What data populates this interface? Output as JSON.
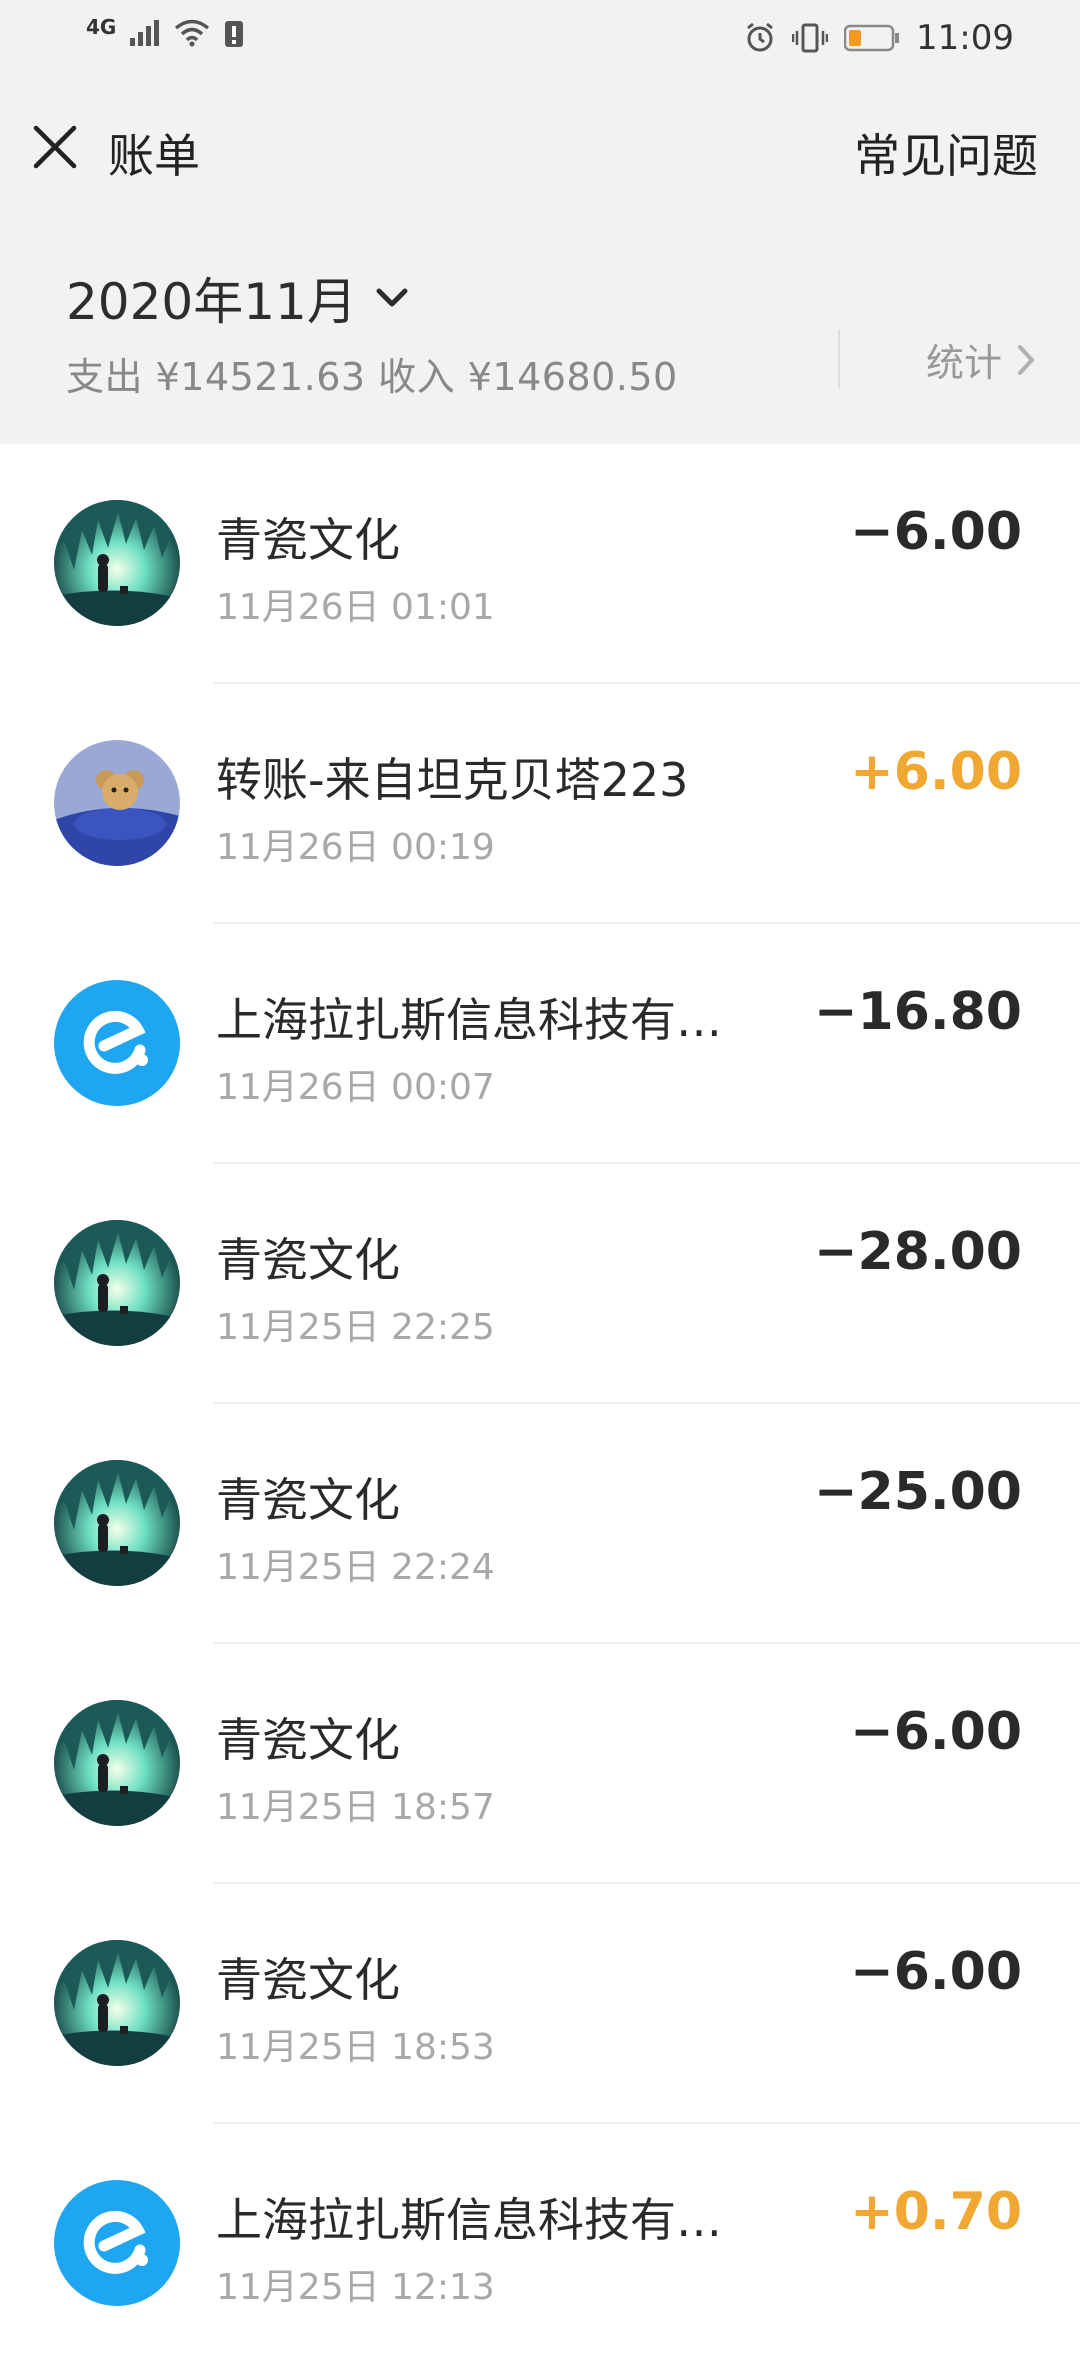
{
  "status_bar": {
    "network": "4G",
    "time": "11:09"
  },
  "nav": {
    "title": "账单",
    "faq_label": "常见问题"
  },
  "summary": {
    "month": "2020年11月",
    "totals_text": "支出 ¥14521.63 收入 ¥14680.50",
    "stats_label": "统计"
  },
  "colors": {
    "income": "#f0a832",
    "expense": "#2a2a2a",
    "eleme_blue": "#1ea7f0"
  },
  "transactions": [
    {
      "title": "青瓷文化",
      "time": "11月26日 01:01",
      "amount": "−6.00",
      "type": "expense",
      "avatar": "cave-night-avatar"
    },
    {
      "title": "转账-来自坦克贝塔223",
      "time": "11月26日 00:19",
      "amount": "+6.00",
      "type": "income",
      "avatar": "bear-avatar"
    },
    {
      "title": "上海拉扎斯信息科技有…",
      "time": "11月26日 00:07",
      "amount": "−16.80",
      "type": "expense",
      "avatar": "eleme-logo"
    },
    {
      "title": "青瓷文化",
      "time": "11月25日 22:25",
      "amount": "−28.00",
      "type": "expense",
      "avatar": "cave-night-avatar"
    },
    {
      "title": "青瓷文化",
      "time": "11月25日 22:24",
      "amount": "−25.00",
      "type": "expense",
      "avatar": "cave-night-avatar"
    },
    {
      "title": "青瓷文化",
      "time": "11月25日 18:57",
      "amount": "−6.00",
      "type": "expense",
      "avatar": "cave-night-avatar"
    },
    {
      "title": "青瓷文化",
      "time": "11月25日 18:53",
      "amount": "−6.00",
      "type": "expense",
      "avatar": "cave-night-avatar"
    },
    {
      "title": "上海拉扎斯信息科技有…",
      "time": "11月25日 12:13",
      "amount": "+0.70",
      "type": "income",
      "avatar": "eleme-logo"
    }
  ]
}
